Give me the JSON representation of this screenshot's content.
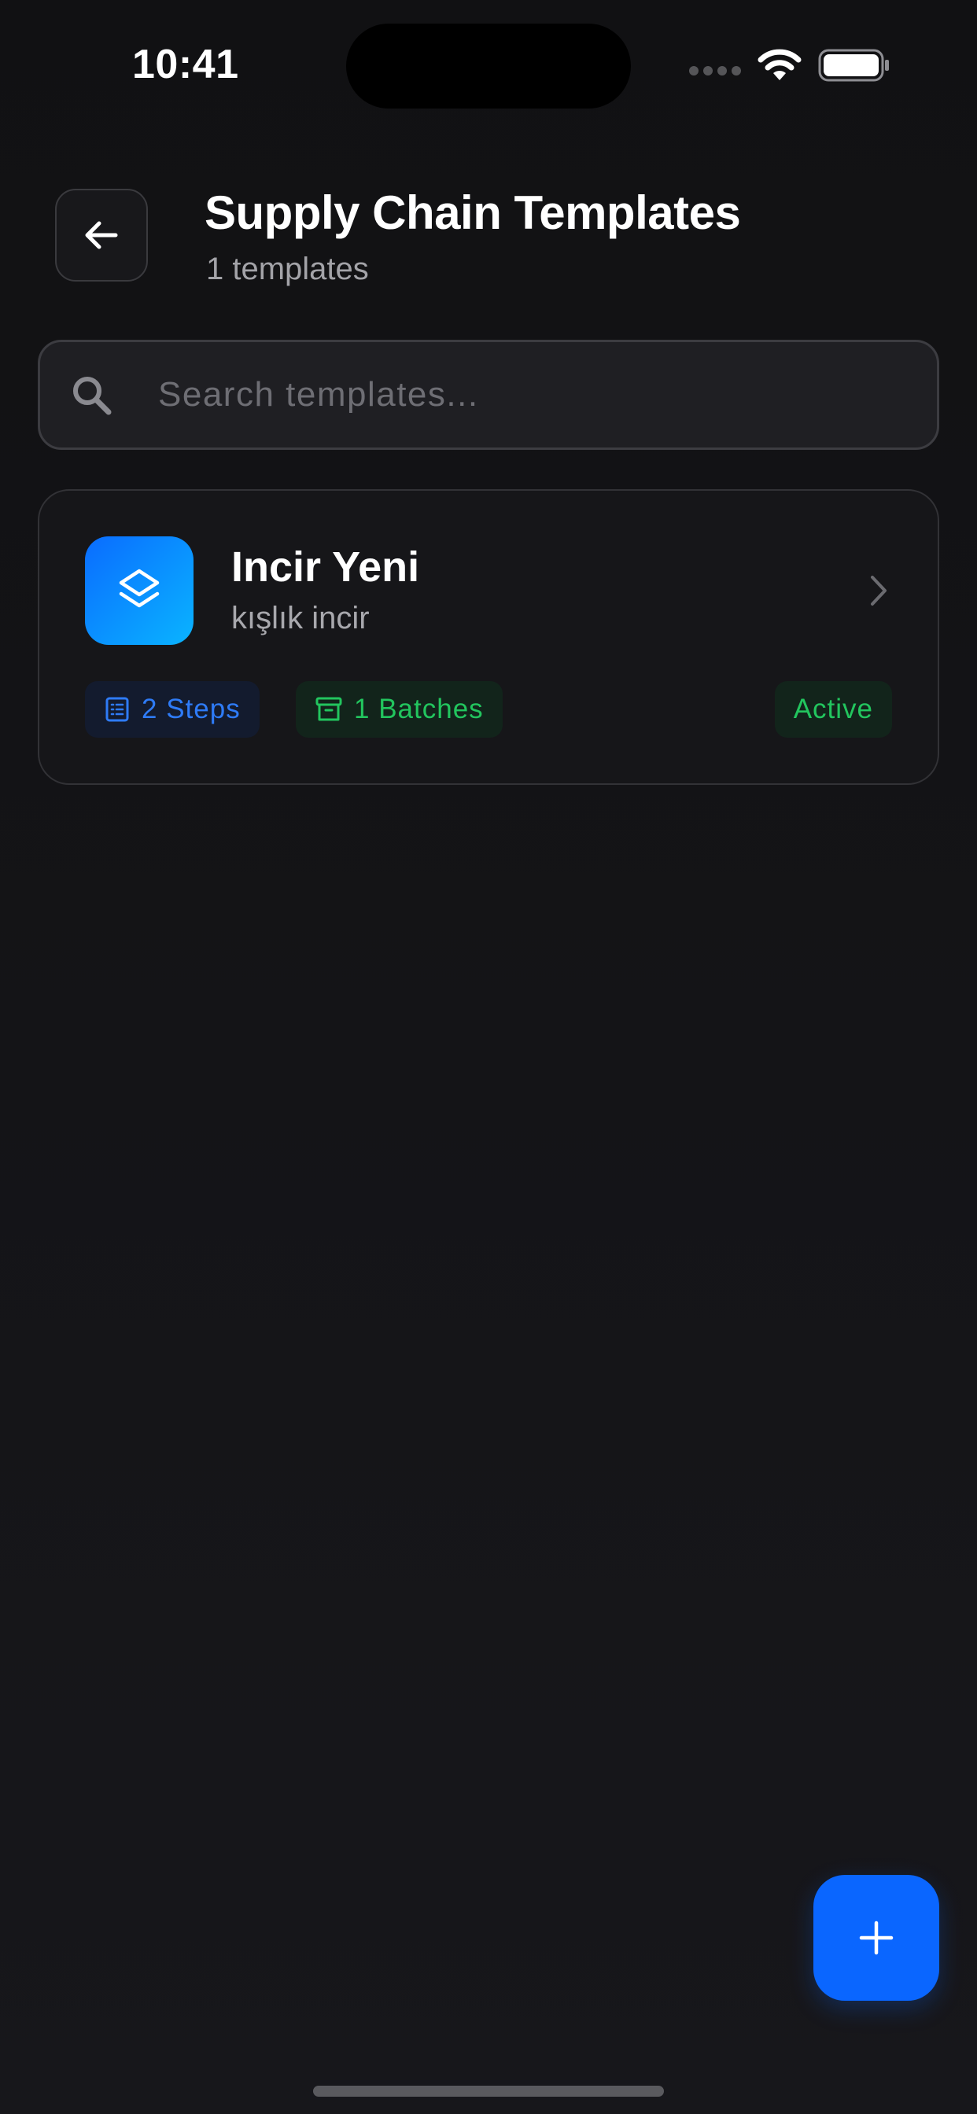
{
  "status_bar": {
    "time": "10:41"
  },
  "header": {
    "title": "Supply Chain Templates",
    "subtitle": "1 templates"
  },
  "search": {
    "placeholder": "Search templates..."
  },
  "templates": [
    {
      "name": "Incir Yeni",
      "description": "kışlık incir",
      "steps_label": "2 Steps",
      "batches_label": "1 Batches",
      "status": "Active"
    }
  ],
  "colors": {
    "accent": "#0a66ff",
    "steps_chip_text": "#2e7bf6",
    "success": "#22c55e",
    "background": "#131316"
  },
  "icons": {
    "back": "arrow-left-icon",
    "search": "search-icon",
    "template": "layers-icon",
    "steps": "list-icon",
    "batches": "archive-icon",
    "open": "chevron-right-icon",
    "add": "plus-icon"
  }
}
